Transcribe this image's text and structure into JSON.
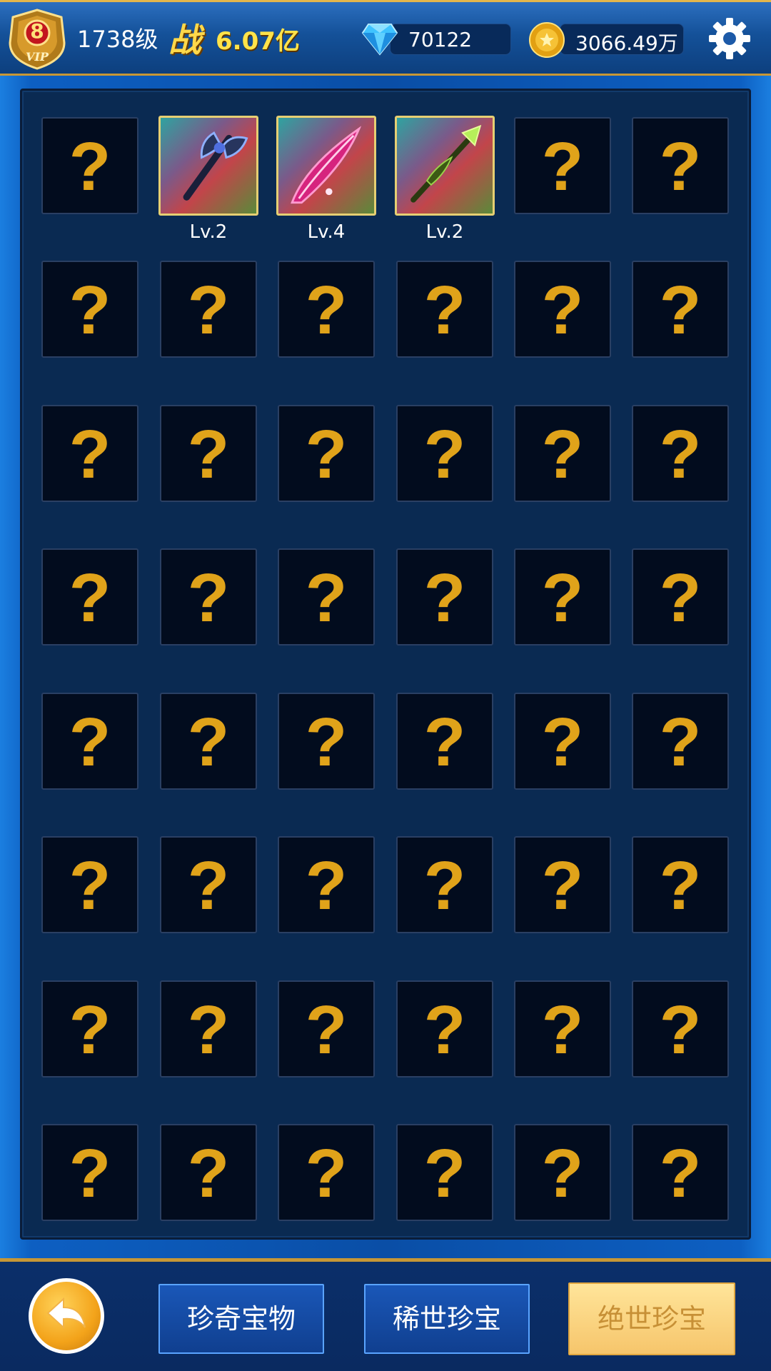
{
  "header": {
    "vip_level": "8",
    "vip_text": "VIP",
    "player_level": "1738级",
    "power_label": "战",
    "power_value": "6.07亿",
    "diamonds": "70122",
    "gold": "3066.49万"
  },
  "grid": {
    "unknown_symbol": "?",
    "items": [
      {
        "name": "battle-axe",
        "level": "Lv.2"
      },
      {
        "name": "pink-crystal-blade",
        "level": "Lv.4"
      },
      {
        "name": "green-spear",
        "level": "Lv.2"
      }
    ]
  },
  "tabs": [
    {
      "label": "珍奇宝物",
      "active": false
    },
    {
      "label": "稀世珍宝",
      "active": false
    },
    {
      "label": "绝世珍宝",
      "active": true
    }
  ],
  "colors": {
    "accent_gold": "#e0a31a",
    "frame_blue": "#0d5fc2",
    "active_tab": "#f6c56b"
  }
}
